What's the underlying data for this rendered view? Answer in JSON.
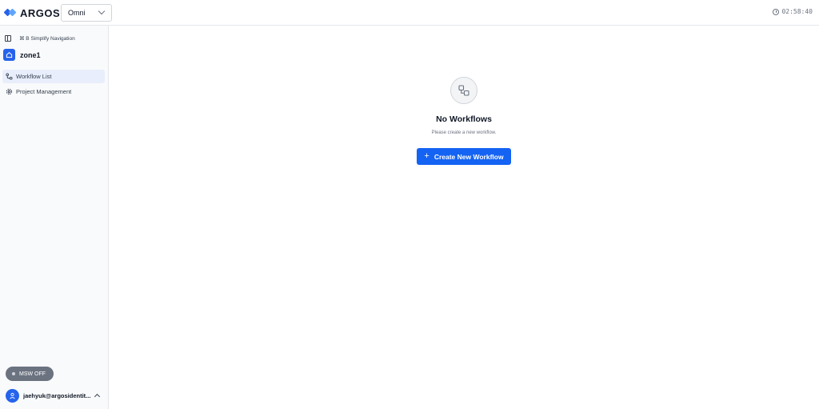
{
  "header": {
    "logo_text": "ARGOS",
    "product_selected": "Omni",
    "clock": "02:58:40"
  },
  "sidebar": {
    "toggle_label": "⌘ B Simplify Navigation",
    "zone": "zone1",
    "items": [
      {
        "label": "Workflow List",
        "icon": "workflow-icon",
        "active": true
      },
      {
        "label": "Project Management",
        "icon": "gear-icon",
        "active": false
      }
    ],
    "msw_label": "MSW OFF",
    "user_email": "jaehyuk@argosidentit..."
  },
  "main": {
    "empty_title": "No Workflows",
    "empty_subtitle": "Please create a new workflow.",
    "create_button": "Create New Workflow"
  },
  "colors": {
    "accent": "#1463f3",
    "active_nav": "#e8eefb"
  }
}
